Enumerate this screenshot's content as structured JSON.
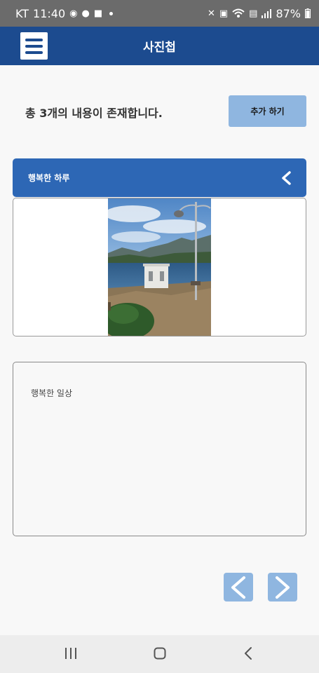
{
  "status_bar": {
    "carrier": "KT",
    "time": "11:40",
    "battery": "87%",
    "icons_left": [
      "screen-record-icon",
      "talk-icon",
      "chat-icon"
    ],
    "icons_right": [
      "mute-icon",
      "lock-icon",
      "wifi-icon",
      "volte-icon",
      "signal-icon",
      "battery-icon"
    ]
  },
  "app_bar": {
    "title": "사진첩"
  },
  "summary": {
    "count_text": "총 3개의 내용이 존재합니다.",
    "add_label": "추가 하기"
  },
  "album": {
    "title": "행복한 하루",
    "description": "행복한 일상"
  },
  "colors": {
    "app_bar": "#1c4b8f",
    "album_header": "#2d67b5",
    "button": "#8fb6e0"
  }
}
